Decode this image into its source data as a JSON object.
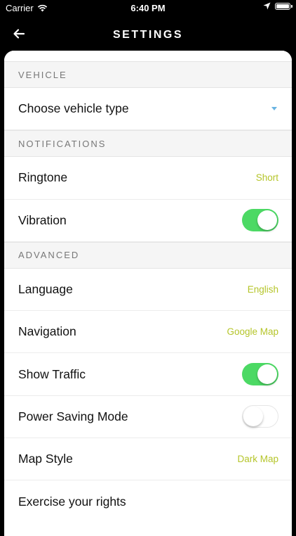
{
  "status_bar": {
    "carrier": "Carrier",
    "time": "6:40 PM"
  },
  "nav": {
    "title": "SETTINGS",
    "back_icon": "arrow-left-icon"
  },
  "sections": {
    "vehicle": {
      "header": "VEHICLE",
      "choose_vehicle_label": "Choose vehicle type"
    },
    "notifications": {
      "header": "NOTIFICATIONS",
      "ringtone_label": "Ringtone",
      "ringtone_value": "Short",
      "vibration_label": "Vibration",
      "vibration_on": true
    },
    "advanced": {
      "header": "ADVANCED",
      "language_label": "Language",
      "language_value": "English",
      "navigation_label": "Navigation",
      "navigation_value": "Google Map",
      "show_traffic_label": "Show Traffic",
      "show_traffic_on": true,
      "power_saving_label": "Power Saving Mode",
      "power_saving_on": false,
      "map_style_label": "Map Style",
      "map_style_value": "Dark Map",
      "exercise_rights_label": "Exercise your rights"
    }
  },
  "colors": {
    "value_text": "#b5c52a",
    "toggle_on": "#4cd964",
    "dropdown_caret": "#6ab4e2",
    "section_bg": "#f5f5f5"
  }
}
